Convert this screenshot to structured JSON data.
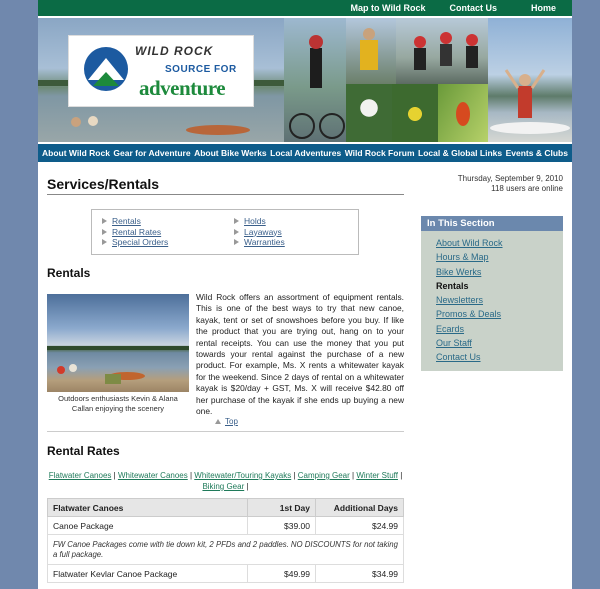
{
  "top_links": [
    "Map to Wild Rock",
    "Contact Us",
    "Home"
  ],
  "logo": {
    "wordmark": "WILD ROCK",
    "source": "SOURCE FOR",
    "adventure": "adventure"
  },
  "nav": [
    "About Wild Rock",
    "Gear for Adventure",
    "About Bike Werks",
    "Local Adventures",
    "Wild Rock Forum",
    "Local & Global Links",
    "Events & Clubs"
  ],
  "page_title": "Services/Rentals",
  "date_info": {
    "date": "Thursday, September 9, 2010",
    "users": "118 users are online"
  },
  "quick_links": {
    "col1": [
      "Rentals",
      "Rental Rates",
      "Special Orders"
    ],
    "col2": [
      "Holds",
      "Layaways",
      "Warranties"
    ]
  },
  "rentals": {
    "heading": "Rentals",
    "caption": "Outdoors enthusiasts Kevin & Alana Callan enjoying the scenery",
    "text": "Wild Rock offers an assortment of equipment rentals. This is one of the best ways to try that new canoe, kayak, tent or set of snowshoes before you buy. If like the product that you are trying out, hang on to your rental receipts. You can use the money that you put towards your rental against the purchase of a new product. For example, Ms. X rents a whitewater kayak for the weekend. Since 2 days of rental on a whitewater kayak is $20/day + GST, Ms. X will receive $42.80 off her purchase of the kayak if she ends up buying a new one.",
    "top_label": "Top"
  },
  "rental_rates": {
    "heading": "Rental Rates",
    "categories": [
      "Flatwater Canoes",
      "Whitewater Canoes",
      "Whitewater/Touring Kayaks",
      "Camping Gear",
      "Winter Stuff",
      "Biking Gear"
    ],
    "table": {
      "headers": [
        "Flatwater Canoes",
        "1st Day",
        "Additional Days"
      ],
      "rows": [
        {
          "item": "Canoe Package",
          "first": "$39.00",
          "additional": "$24.99"
        },
        {
          "note": "FW Canoe Packages come with tie down kit, 2 PFDs and 2 paddles. NO DISCOUNTS for not taking a full package."
        },
        {
          "item": "Flatwater Kevlar Canoe Package",
          "first": "$49.99",
          "additional": "$34.99"
        }
      ]
    }
  },
  "in_this_section": {
    "heading": "In This Section",
    "items": [
      "About Wild Rock",
      "Hours & Map",
      "Bike Werks",
      "Rentals",
      "Newsletters",
      "Promos & Deals",
      "Ecards",
      "Our Staff",
      "Contact Us"
    ],
    "current": "Rentals"
  },
  "colors": {
    "top_bar": "#0b6b45",
    "nav_bar": "#0e5c8a",
    "section_head": "#6b88ad",
    "background": "#7088ad"
  }
}
